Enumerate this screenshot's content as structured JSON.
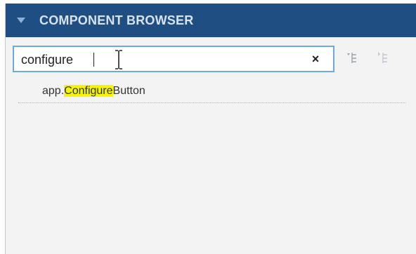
{
  "header": {
    "title": "COMPONENT BROWSER",
    "collapse_icon": "triangle-down-icon"
  },
  "search": {
    "value": "configure",
    "clear_label": "×"
  },
  "toolbar": {
    "expand_icon": "expand-all-icon",
    "collapse_icon": "collapse-all-icon"
  },
  "results": [
    {
      "prefix": "app.",
      "match": "Configure",
      "suffix": "Button"
    }
  ],
  "colors": {
    "header_bg": "#1f4e82",
    "highlight": "#f5f500",
    "search_border": "#6fa8dc"
  }
}
